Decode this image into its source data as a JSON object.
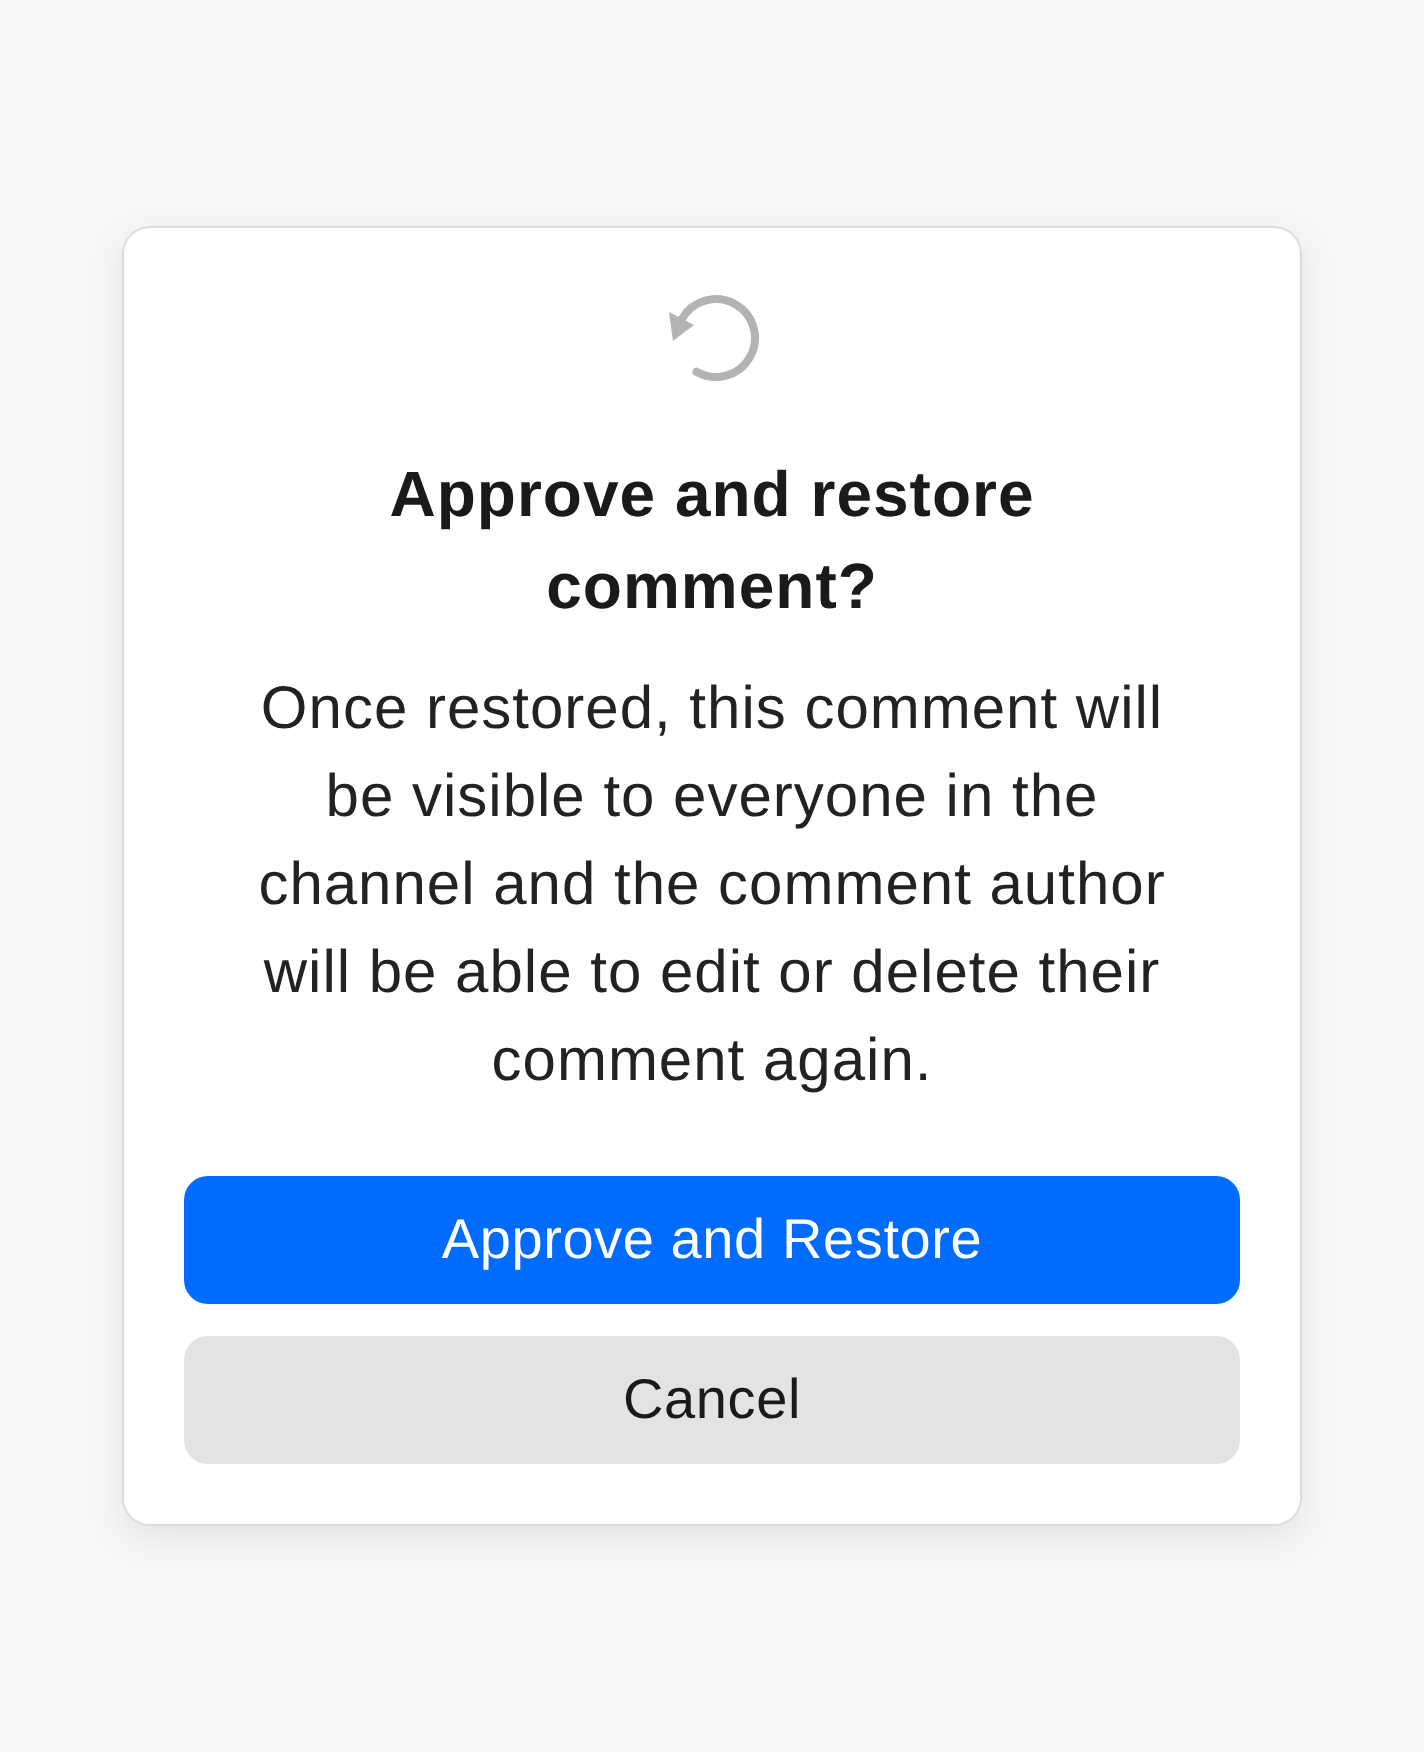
{
  "dialog": {
    "title": "Approve and restore comment?",
    "message": "Once restored, this comment will be visible to everyone in the channel and the comment author will be able to edit or delete their comment again.",
    "buttons": [
      {
        "label": "Approve and Restore",
        "kind": "primary"
      },
      {
        "label": "Cancel",
        "kind": "secondary"
      }
    ]
  }
}
